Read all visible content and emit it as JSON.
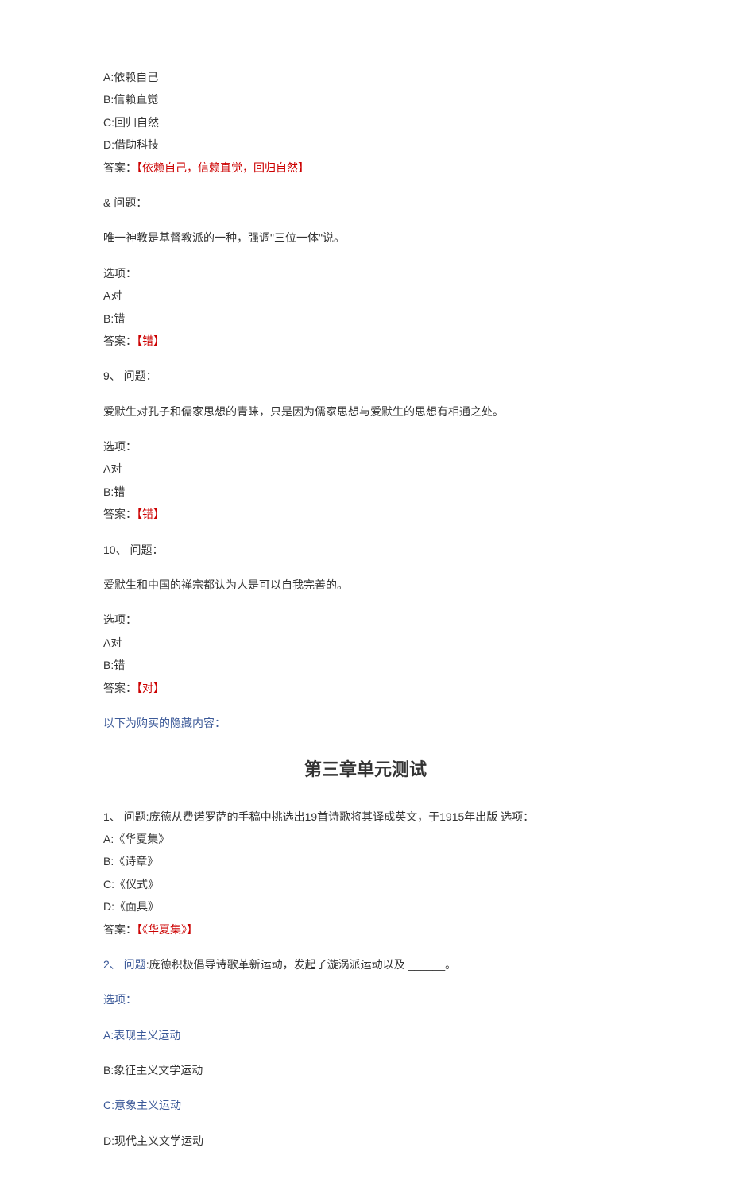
{
  "q7": {
    "optA": "A:依赖自己",
    "optB": "B:信赖直觉",
    "optC": "C:回归自然",
    "optD": "D:借助科技",
    "answer_label": "答案：",
    "answer_value": "【依赖自己，信赖直觉，回归自然】"
  },
  "q8": {
    "marker": "&  问题：",
    "text": "唯一神教是基督教派的一种，强调\"三位一体\"说。",
    "opts_label": "选项：",
    "optA": "A对",
    "optB": "B:错",
    "answer_label": "答案：",
    "answer_value": "【错】"
  },
  "q9": {
    "marker": "9、   问题：",
    "text": "爱默生对孔子和儒家思想的青睐，只是因为儒家思想与爱默生的思想有相通之处。",
    "opts_label": "选项：",
    "optA": "A对",
    "optB": "B:错",
    "answer_label": "答案：",
    "answer_value": "【错】"
  },
  "q10": {
    "marker": "10、 问题：",
    "text": "爱默生和中国的禅宗都认为人是可以自我完善的。",
    "opts_label": "选项：",
    "optA": "A对",
    "optB": "B:错",
    "answer_label": "答案：",
    "answer_value": "【对】"
  },
  "hidden_note": "以下为购买的隐藏内容：",
  "chapter_heading": "第三章单元测试",
  "c3q1": {
    "marker": "1、   问题:庞德从费诺罗萨的手稿中挑选出19首诗歌将其译成英文，于1915年出版  选项：",
    "optA": "A:《华夏集》",
    "optB": "B:《诗章》",
    "optC": "C:《仪式》",
    "optD": "D:《面具》",
    "answer_label": "答案：",
    "answer_value": "【《华夏集》】"
  },
  "c3q2": {
    "marker": "2、   问题",
    "text": ":庞德积极倡导诗歌革新运动，发起了漩涡派运动以及 ______。",
    "opts_label": "选项：",
    "optA": "A:表现主义运动",
    "optB": "B:象征主义文学运动",
    "optC": "C:意象主义运动",
    "optD": "D:现代主义文学运动"
  }
}
